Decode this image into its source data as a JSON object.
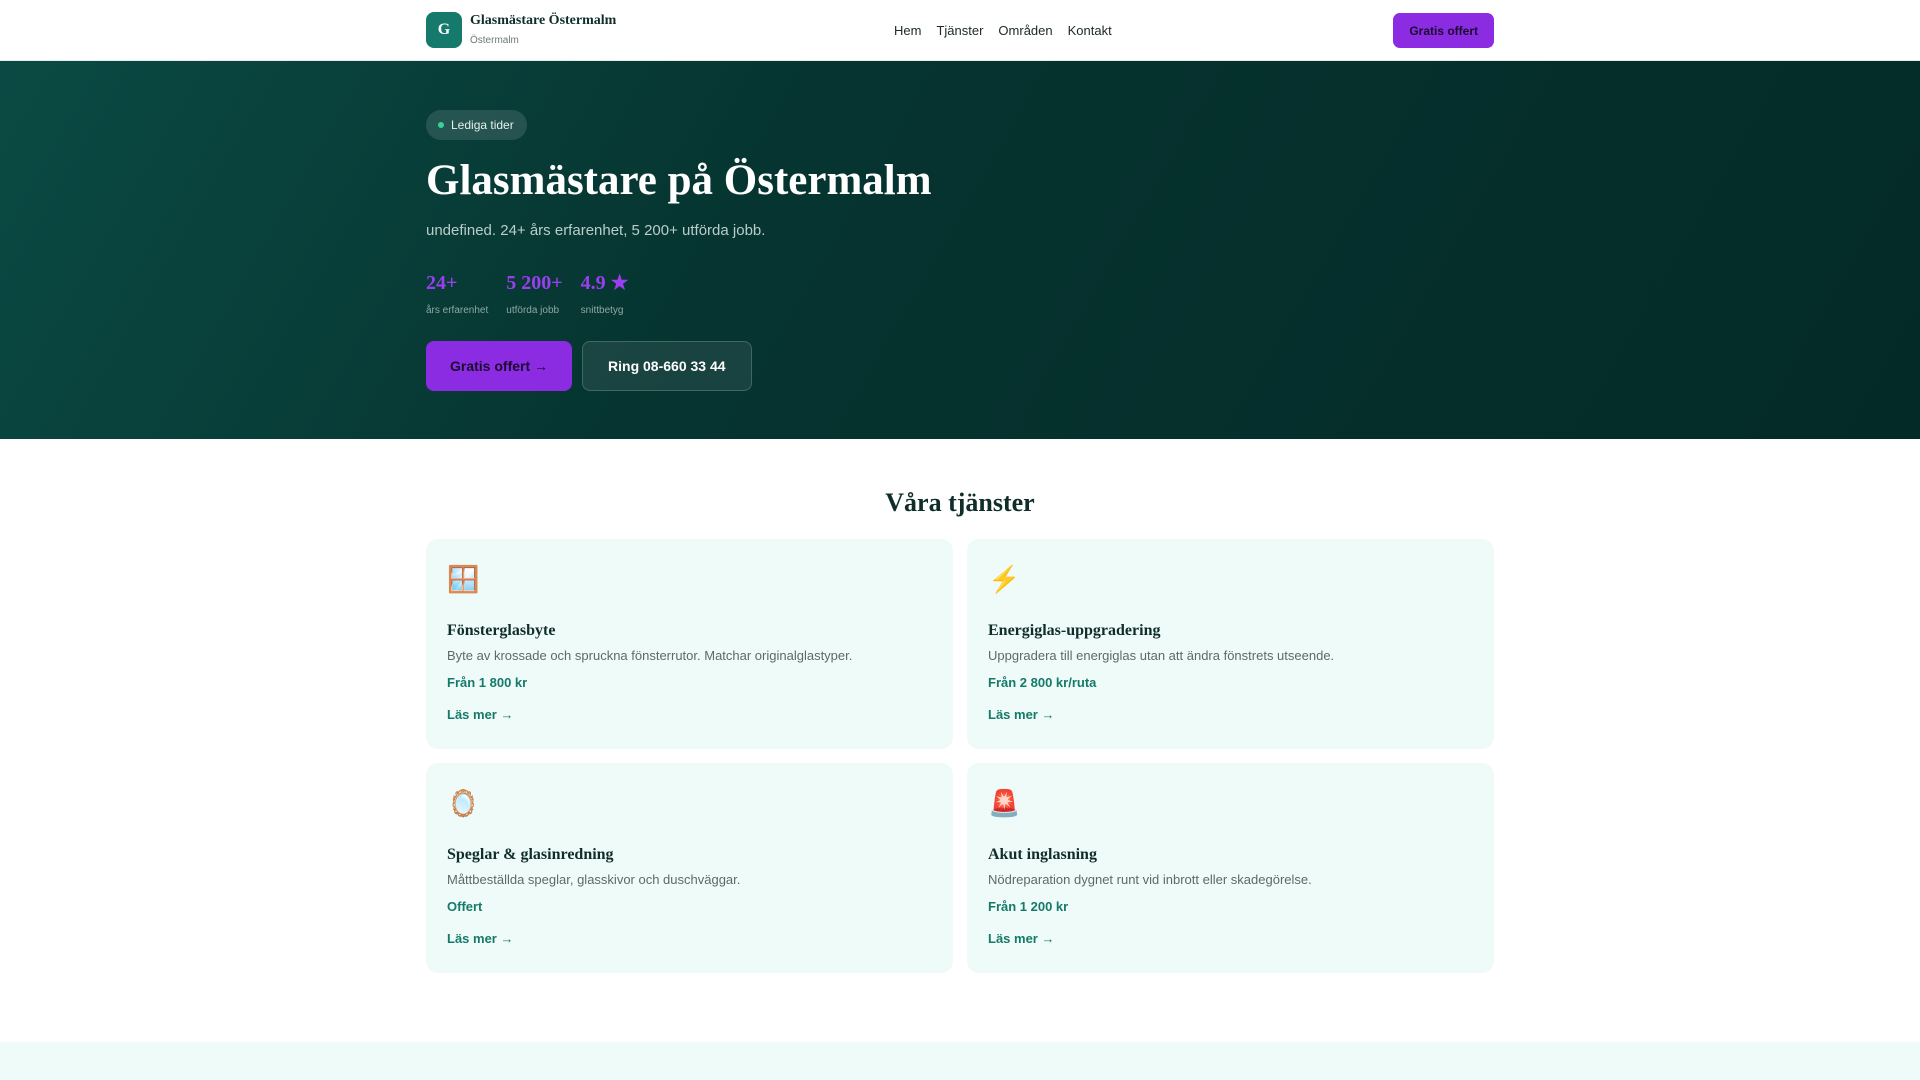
{
  "header": {
    "logo_letter": "G",
    "brand_name": "Glasmästare Östermalm",
    "brand_sub": "Östermalm",
    "nav": [
      {
        "label": "Hem"
      },
      {
        "label": "Tjänster"
      },
      {
        "label": "Områden"
      },
      {
        "label": "Kontakt"
      }
    ],
    "cta_label": "Gratis offert"
  },
  "hero": {
    "badge": "Lediga tider",
    "title": "Glasmästare på Östermalm",
    "subtitle": "undefined. 24+ års erfarenhet, 5 200+ utförda jobb.",
    "stats": [
      {
        "value": "24+",
        "label": "års erfarenhet"
      },
      {
        "value": "5 200+",
        "label": "utförda jobb"
      },
      {
        "value": "4.9 ★",
        "label": "snittbetyg"
      }
    ],
    "primary_button": "Gratis offert →",
    "secondary_button": "Ring 08-660 33 44"
  },
  "services": {
    "title": "Våra tjänster",
    "cards": [
      {
        "icon": "🪟",
        "icon_name": "window-icon",
        "title": "Fönsterglasbyte",
        "description": "Byte av krossade och spruckna fönsterrutor. Matchar originalglastyper.",
        "price": "Från 1 800 kr",
        "link": "Läs mer →"
      },
      {
        "icon": "⚡",
        "icon_name": "lightning-icon",
        "title": "Energiglas-uppgradering",
        "description": "Uppgradera till energiglas utan att ändra fönstrets utseende.",
        "price": "Från 2 800 kr/ruta",
        "link": "Läs mer →"
      },
      {
        "icon": "🪞",
        "icon_name": "mirror-icon",
        "title": "Speglar & glasinredning",
        "description": "Måttbeställda speglar, glasskivor och duschväggar.",
        "price": "Offert",
        "link": "Läs mer →"
      },
      {
        "icon": "🚨",
        "icon_name": "siren-icon",
        "title": "Akut inglasning",
        "description": "Nödreparation dygnet runt vid inbrott eller skadegörelse.",
        "price": "Från 1 200 kr",
        "link": "Läs mer →"
      }
    ]
  },
  "colors": {
    "accent": "#8b2be2",
    "brand": "#157a6b",
    "hero_bg": "#063430",
    "card_bg": "#effbf8"
  }
}
